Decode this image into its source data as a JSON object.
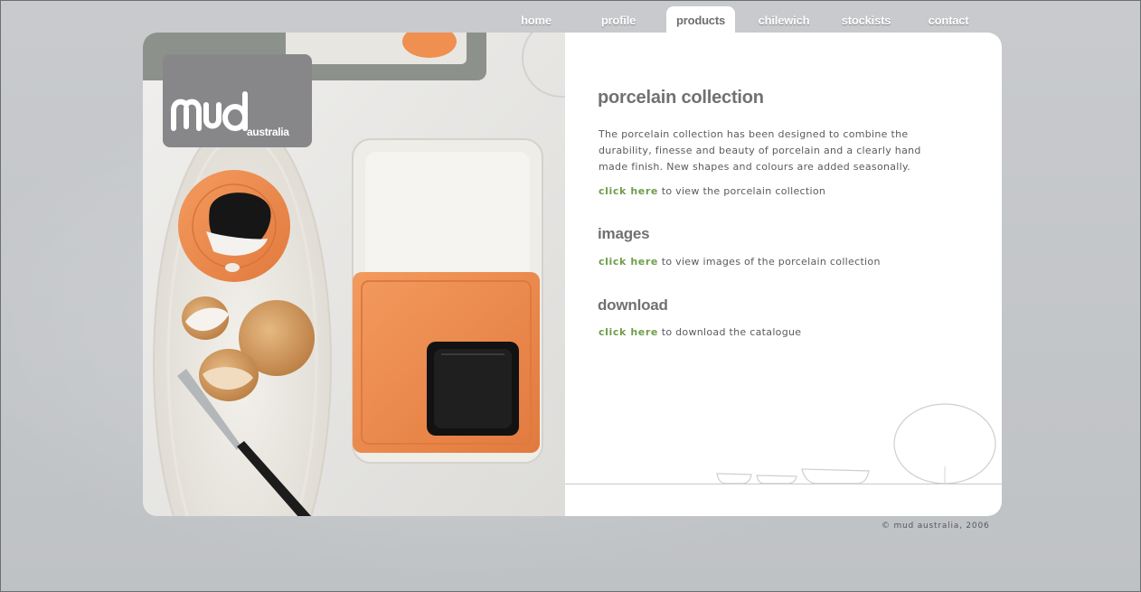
{
  "nav": {
    "tabs": [
      {
        "label": "home",
        "active": false
      },
      {
        "label": "profile",
        "active": false
      },
      {
        "label": "products",
        "active": true
      },
      {
        "label": "chilewich",
        "active": false
      },
      {
        "label": "stockists",
        "active": false
      },
      {
        "label": "contact",
        "active": false
      }
    ]
  },
  "logo": {
    "word": "mud",
    "sub": "australia",
    "tm": "™"
  },
  "sections": {
    "collection": {
      "title": "porcelain collection",
      "description": "The porcelain collection has been designed to combine the durability, finesse and beauty of porcelain and a clearly hand made finish. New shapes and colours are added seasonally.",
      "link": "click here",
      "link_suffix": " to view the porcelain collection"
    },
    "images": {
      "title": "images",
      "link": "click here",
      "link_suffix": " to view images of the porcelain collection"
    },
    "download": {
      "title": "download",
      "link": "click here",
      "link_suffix": " to download the catalogue"
    }
  },
  "footer": {
    "copyright": "© mud australia, 2006"
  },
  "colors": {
    "accent_link": "#6f9e4a",
    "heading": "#707173",
    "background": "#c3c6c9",
    "orange": "#ee8a4f"
  }
}
